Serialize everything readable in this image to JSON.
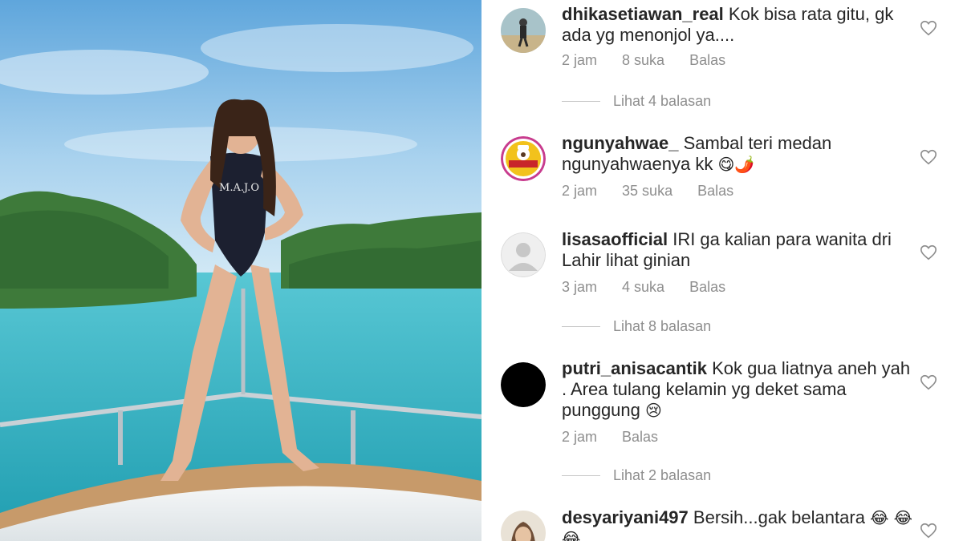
{
  "comments": [
    {
      "username": "dhikasetiawan_real",
      "text": "Kok bisa rata gitu, gk ada yg menonjol ya....",
      "time": "2 jam",
      "likes": "8 suka",
      "reply_label": "Balas",
      "view_replies": "Lihat 4 balasan"
    },
    {
      "username": "ngunyahwae_",
      "text": "Sambal teri medan ngunyahwaenya kk",
      "emoji": "😋🌶️",
      "time": "2 jam",
      "likes": "35 suka",
      "reply_label": "Balas"
    },
    {
      "username": "lisasaofficial",
      "text": "IRI ga kalian para wanita dri Lahir lihat ginian",
      "time": "3 jam",
      "likes": "4 suka",
      "reply_label": "Balas",
      "view_replies": "Lihat 8 balasan"
    },
    {
      "username": "putri_anisacantik",
      "text": "Kok gua liatnya aneh yah . Area  tulang kelamin yg deket sama punggung",
      "emoji": "😢",
      "time": "2 jam",
      "reply_label": "Balas",
      "view_replies": "Lihat 2 balasan"
    },
    {
      "username": "desyariyani497",
      "text": "Bersih...gak belantara",
      "emoji": "😂",
      "emoji_line2": "😂😂"
    }
  ],
  "photo": {
    "swimsuit_text": "M.A.J.O"
  },
  "colors": {
    "text": "#262626",
    "secondary": "#8e8e8e",
    "sky": "#8ec3e6",
    "sea": "#3fb7c4",
    "trees": "#3e7a3a"
  }
}
